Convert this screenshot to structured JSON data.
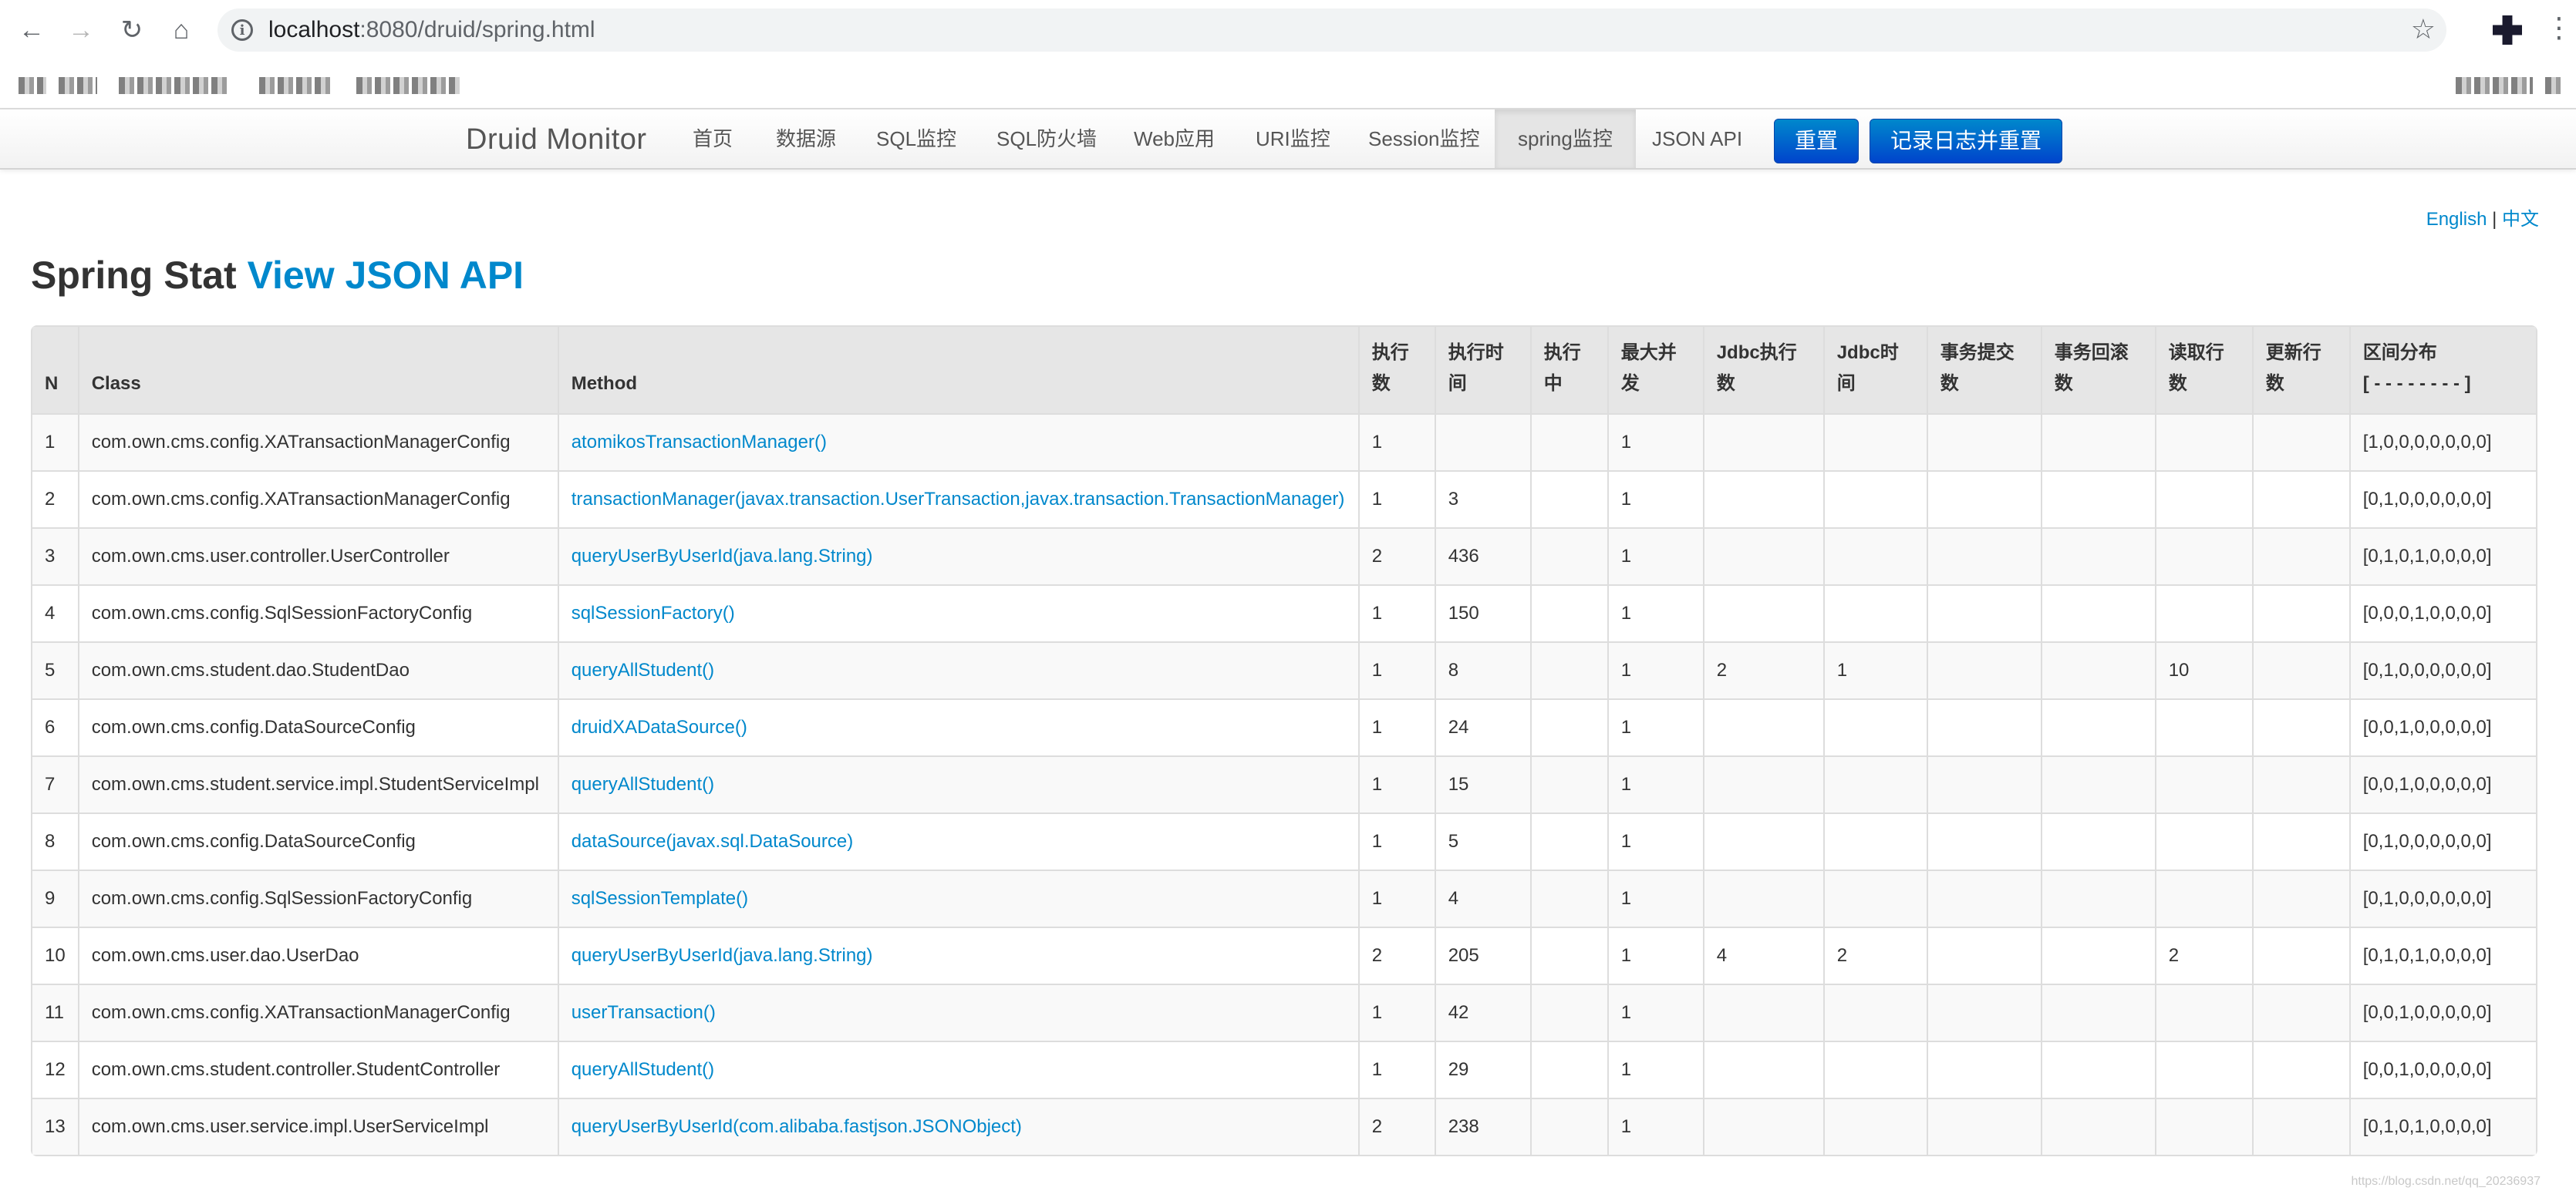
{
  "browser": {
    "url_host": "localhost",
    "url_path": ":8080/druid/spring.html",
    "icons": [
      "back-arrow-icon",
      "forward-arrow-icon",
      "reload-icon",
      "home-icon",
      "info-icon",
      "star-icon",
      "extension-icon",
      "kebab-menu-icon"
    ]
  },
  "navbar": {
    "brand": "Druid Monitor",
    "items": [
      {
        "label": "首页"
      },
      {
        "label": "数据源"
      },
      {
        "label": "SQL监控"
      },
      {
        "label": "SQL防火墙"
      },
      {
        "label": "Web应用"
      },
      {
        "label": "URI监控"
      },
      {
        "label": "Session监控"
      },
      {
        "label": "spring监控",
        "active": true
      },
      {
        "label": "JSON API"
      }
    ],
    "reset_button": "重置",
    "log_reset_button": "记录日志并重置"
  },
  "lang": {
    "english": "English",
    "separator": "|",
    "chinese": "中文"
  },
  "page": {
    "title": "Spring Stat",
    "title_link": "View JSON API"
  },
  "table": {
    "headers": {
      "n": "N",
      "class": "Class",
      "method": "Method",
      "exec_count_1": "执行",
      "exec_count_2": "数",
      "exec_time_1": "执行时",
      "exec_time_2": "间",
      "running_1": "执行",
      "running_2": "中",
      "max_concurrent_1": "最大并",
      "max_concurrent_2": "发",
      "jdbc_exec_1": "Jdbc执行",
      "jdbc_exec_2": "数",
      "jdbc_time_1": "Jdbc时",
      "jdbc_time_2": "间",
      "tx_commit_1": "事务提交",
      "tx_commit_2": "数",
      "tx_rollback_1": "事务回滚",
      "tx_rollback_2": "数",
      "read_rows_1": "读取行",
      "read_rows_2": "数",
      "update_rows_1": "更新行",
      "update_rows_2": "数",
      "histogram_1": "区间分布",
      "histogram_2": "[ - - - - - - - - ]"
    },
    "rows": [
      {
        "n": "1",
        "class": "com.own.cms.config.XATransactionManagerConfig",
        "method": "atomikosTransactionManager()",
        "exec_count": "1",
        "exec_time": "",
        "running": "",
        "max_concurrent": "1",
        "jdbc_exec": "",
        "jdbc_time": "",
        "tx_commit": "",
        "tx_rollback": "",
        "read_rows": "",
        "update_rows": "",
        "histogram": "[1,0,0,0,0,0,0,0]"
      },
      {
        "n": "2",
        "class": "com.own.cms.config.XATransactionManagerConfig",
        "method": "transactionManager(javax.transaction.UserTransaction,javax.transaction.TransactionManager)",
        "exec_count": "1",
        "exec_time": "3",
        "running": "",
        "max_concurrent": "1",
        "jdbc_exec": "",
        "jdbc_time": "",
        "tx_commit": "",
        "tx_rollback": "",
        "read_rows": "",
        "update_rows": "",
        "histogram": "[0,1,0,0,0,0,0,0]"
      },
      {
        "n": "3",
        "class": "com.own.cms.user.controller.UserController",
        "method": "queryUserByUserId(java.lang.String)",
        "exec_count": "2",
        "exec_time": "436",
        "running": "",
        "max_concurrent": "1",
        "jdbc_exec": "",
        "jdbc_time": "",
        "tx_commit": "",
        "tx_rollback": "",
        "read_rows": "",
        "update_rows": "",
        "histogram": "[0,1,0,1,0,0,0,0]"
      },
      {
        "n": "4",
        "class": "com.own.cms.config.SqlSessionFactoryConfig",
        "method": "sqlSessionFactory()",
        "exec_count": "1",
        "exec_time": "150",
        "running": "",
        "max_concurrent": "1",
        "jdbc_exec": "",
        "jdbc_time": "",
        "tx_commit": "",
        "tx_rollback": "",
        "read_rows": "",
        "update_rows": "",
        "histogram": "[0,0,0,1,0,0,0,0]"
      },
      {
        "n": "5",
        "class": "com.own.cms.student.dao.StudentDao",
        "method": "queryAllStudent()",
        "exec_count": "1",
        "exec_time": "8",
        "running": "",
        "max_concurrent": "1",
        "jdbc_exec": "2",
        "jdbc_time": "1",
        "tx_commit": "",
        "tx_rollback": "",
        "read_rows": "10",
        "update_rows": "",
        "histogram": "[0,1,0,0,0,0,0,0]"
      },
      {
        "n": "6",
        "class": "com.own.cms.config.DataSourceConfig",
        "method": "druidXADataSource()",
        "exec_count": "1",
        "exec_time": "24",
        "running": "",
        "max_concurrent": "1",
        "jdbc_exec": "",
        "jdbc_time": "",
        "tx_commit": "",
        "tx_rollback": "",
        "read_rows": "",
        "update_rows": "",
        "histogram": "[0,0,1,0,0,0,0,0]"
      },
      {
        "n": "7",
        "class": "com.own.cms.student.service.impl.StudentServiceImpl",
        "method": "queryAllStudent()",
        "exec_count": "1",
        "exec_time": "15",
        "running": "",
        "max_concurrent": "1",
        "jdbc_exec": "",
        "jdbc_time": "",
        "tx_commit": "",
        "tx_rollback": "",
        "read_rows": "",
        "update_rows": "",
        "histogram": "[0,0,1,0,0,0,0,0]"
      },
      {
        "n": "8",
        "class": "com.own.cms.config.DataSourceConfig",
        "method": "dataSource(javax.sql.DataSource)",
        "exec_count": "1",
        "exec_time": "5",
        "running": "",
        "max_concurrent": "1",
        "jdbc_exec": "",
        "jdbc_time": "",
        "tx_commit": "",
        "tx_rollback": "",
        "read_rows": "",
        "update_rows": "",
        "histogram": "[0,1,0,0,0,0,0,0]"
      },
      {
        "n": "9",
        "class": "com.own.cms.config.SqlSessionFactoryConfig",
        "method": "sqlSessionTemplate()",
        "exec_count": "1",
        "exec_time": "4",
        "running": "",
        "max_concurrent": "1",
        "jdbc_exec": "",
        "jdbc_time": "",
        "tx_commit": "",
        "tx_rollback": "",
        "read_rows": "",
        "update_rows": "",
        "histogram": "[0,1,0,0,0,0,0,0]"
      },
      {
        "n": "10",
        "class": "com.own.cms.user.dao.UserDao",
        "method": "queryUserByUserId(java.lang.String)",
        "exec_count": "2",
        "exec_time": "205",
        "running": "",
        "max_concurrent": "1",
        "jdbc_exec": "4",
        "jdbc_time": "2",
        "tx_commit": "",
        "tx_rollback": "",
        "read_rows": "2",
        "update_rows": "",
        "histogram": "[0,1,0,1,0,0,0,0]"
      },
      {
        "n": "11",
        "class": "com.own.cms.config.XATransactionManagerConfig",
        "method": "userTransaction()",
        "exec_count": "1",
        "exec_time": "42",
        "running": "",
        "max_concurrent": "1",
        "jdbc_exec": "",
        "jdbc_time": "",
        "tx_commit": "",
        "tx_rollback": "",
        "read_rows": "",
        "update_rows": "",
        "histogram": "[0,0,1,0,0,0,0,0]"
      },
      {
        "n": "12",
        "class": "com.own.cms.student.controller.StudentController",
        "method": "queryAllStudent()",
        "exec_count": "1",
        "exec_time": "29",
        "running": "",
        "max_concurrent": "1",
        "jdbc_exec": "",
        "jdbc_time": "",
        "tx_commit": "",
        "tx_rollback": "",
        "read_rows": "",
        "update_rows": "",
        "histogram": "[0,0,1,0,0,0,0,0]"
      },
      {
        "n": "13",
        "class": "com.own.cms.user.service.impl.UserServiceImpl",
        "method": "queryUserByUserId(com.alibaba.fastjson.JSONObject)",
        "exec_count": "2",
        "exec_time": "238",
        "running": "",
        "max_concurrent": "1",
        "jdbc_exec": "",
        "jdbc_time": "",
        "tx_commit": "",
        "tx_rollback": "",
        "read_rows": "",
        "update_rows": "",
        "histogram": "[0,1,0,1,0,0,0,0]"
      }
    ]
  },
  "colors": {
    "link": "#0088cc",
    "header_bg": "#e6e6e6",
    "stripe": "#f9f9f9",
    "primary_button": "#0055cc"
  },
  "watermark": "https://blog.csdn.net/qq_20236937"
}
